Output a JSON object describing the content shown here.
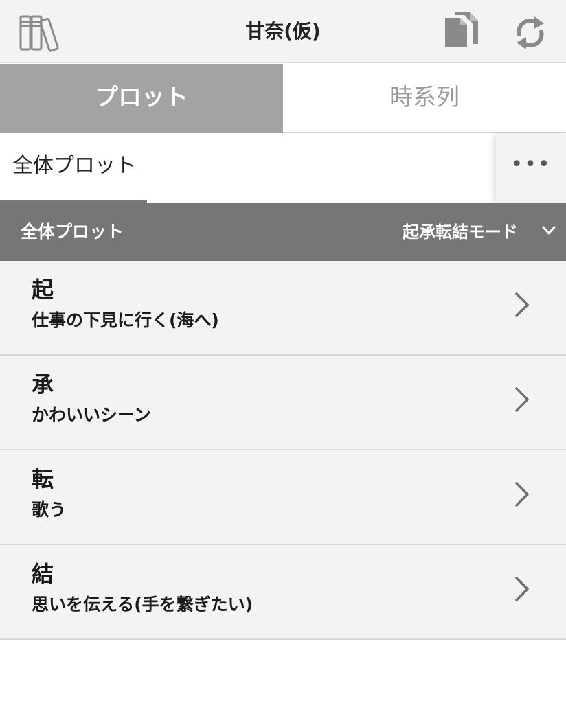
{
  "header": {
    "title": "甘奈(仮)",
    "library_icon": "books-icon",
    "copy_icon": "copy-documents-icon",
    "sync_icon": "sync-icon"
  },
  "tabs": [
    {
      "label": "プロット",
      "active": true
    },
    {
      "label": "時系列",
      "active": false
    }
  ],
  "subtabs": {
    "items": [
      {
        "label": "全体プロット",
        "active": true
      }
    ],
    "more_label": "•••"
  },
  "section": {
    "title": "全体プロット",
    "mode_label": "起承転結モード"
  },
  "plot_items": [
    {
      "label": "起",
      "description": "仕事の下見に行く(海へ)"
    },
    {
      "label": "承",
      "description": "かわいいシーン"
    },
    {
      "label": "転",
      "description": "歌う"
    },
    {
      "label": "結",
      "description": "思いを伝える(手を繋ぎたい)"
    }
  ],
  "colors": {
    "header_bg": "#f3f3f3",
    "active_tab_bg": "#a3a3a3",
    "section_bg": "#767676",
    "row_bg": "#f3f3f3",
    "icon_gray": "#8a8a8a"
  }
}
